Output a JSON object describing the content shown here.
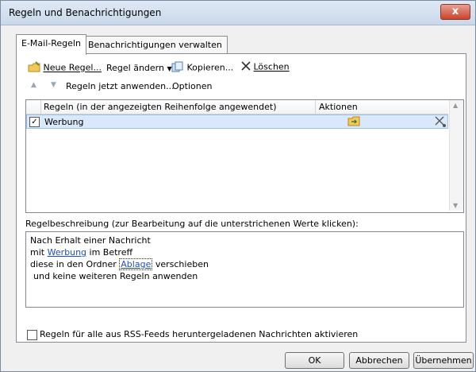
{
  "window": {
    "title": "Regeln und Benachrichtigungen",
    "close_glyph": "x"
  },
  "tabs": [
    {
      "label": "E-Mail-Regeln",
      "active": true
    },
    {
      "label": "Benachrichtigungen verwalten",
      "active": false
    }
  ],
  "toolbar": {
    "new_rule": "Neue Regel...",
    "change_rule": "Regel ändern",
    "copy": "Kopieren...",
    "delete": "Löschen"
  },
  "toolbar2": {
    "apply_now": "Regeln jetzt anwenden...",
    "options": "Optionen"
  },
  "rules_table": {
    "columns": [
      "Regeln (in der angezeigten Reihenfolge angewendet)",
      "Aktionen"
    ],
    "rows": [
      {
        "checked": true,
        "name": "Werbung"
      }
    ]
  },
  "description": {
    "label": "Regelbeschreibung (zur Bearbeitung auf die unterstrichenen Werte klicken):",
    "line1": "Nach Erhalt einer Nachricht",
    "line2_prefix": "mit",
    "line2_link": "Werbung",
    "line2_suffix": "im Betreff",
    "line3_prefix": "diese in den Ordner",
    "line3_link": "Ablage",
    "line3_suffix": "verschieben",
    "line4": "und keine weiteren Regeln anwenden"
  },
  "rss_checkbox": {
    "label": "Regeln für alle aus RSS-Feeds heruntergeladenen Nachrichten aktivieren",
    "checked": false
  },
  "buttons": {
    "ok": "OK",
    "cancel": "Abbrechen",
    "apply": "Übernehmen"
  }
}
